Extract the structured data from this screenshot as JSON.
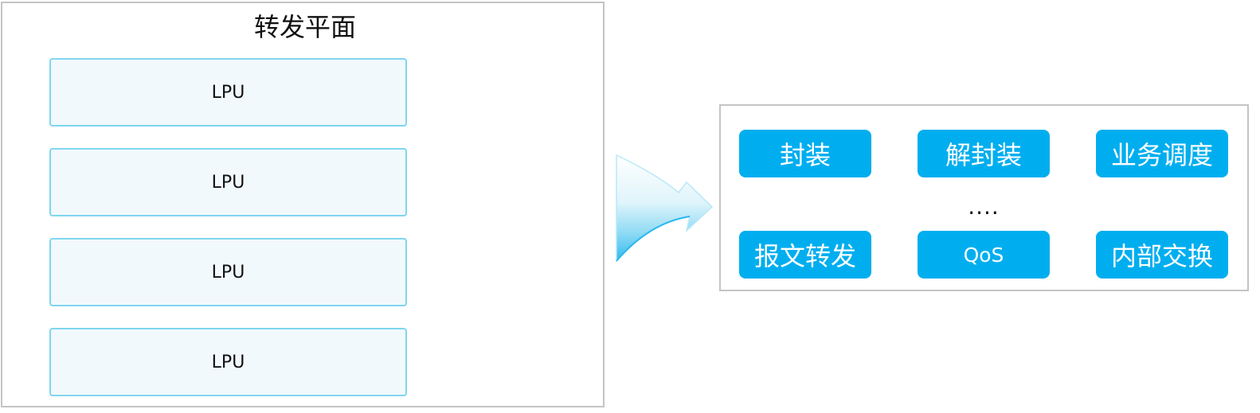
{
  "forwarding_plane": {
    "title": "转发平面",
    "lpu_cards": [
      "LPU",
      "LPU",
      "LPU",
      "LPU"
    ]
  },
  "functions_panel": {
    "row1": [
      "封装",
      "解封装",
      "业务调度"
    ],
    "ellipsis": "....",
    "row2": [
      "报文转发",
      "QoS",
      "内部交换"
    ]
  },
  "colors": {
    "panel_border": "#c4c4c4",
    "lpu_border": "#7fd6ee",
    "lpu_fill": "#f1f9fd",
    "function_fill": "#00aeef",
    "arrow_gradient": [
      "#ffffff",
      "#8ad9f4",
      "#30b9ee"
    ]
  },
  "icons": {
    "transition_arrow": "curved-right-arrow-icon"
  }
}
